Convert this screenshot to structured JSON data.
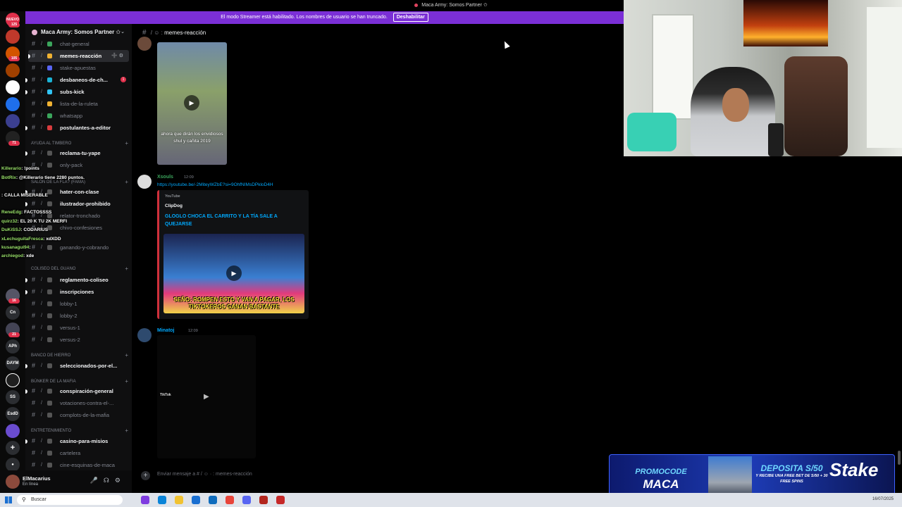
{
  "window": {
    "title": "Maca Army: Somos Partner ✩"
  },
  "banner": {
    "text": "El modo Streamer está habilitado. Los nombres de usuario se han truncado.",
    "button": "Deshabilitar"
  },
  "rail": {
    "badges": [
      "NUEVO",
      "125",
      "105",
      "71",
      "16",
      "21"
    ],
    "labels": [
      "APh",
      "DAYM",
      "SS",
      "EsdD",
      "Cn"
    ]
  },
  "server": {
    "name": "Maca Army: Somos Partner ✩"
  },
  "channels": [
    {
      "label": "chat-general",
      "bold": false,
      "color": "#3ba55c"
    },
    {
      "label": "memes-reacción",
      "bold": true,
      "active": true,
      "color": "#f0b232"
    },
    {
      "label": "stake-apuestas",
      "bold": false,
      "color": "#5865f2"
    },
    {
      "label": "desbaneos-de-ch...",
      "bold": true,
      "color": "#1bb3d6",
      "badge": "1"
    },
    {
      "label": "subs-kick",
      "bold": true,
      "color": "#31c4f3"
    },
    {
      "label": "lista-de-la-ruleta",
      "bold": false,
      "color": "#f0b232"
    },
    {
      "label": "whatsapp",
      "bold": false,
      "color": "#3ba55c"
    },
    {
      "label": "postulantes-a-editor",
      "bold": true,
      "color": "#d83c3e"
    }
  ],
  "categories": [
    {
      "label": "AYUDA AL TIMBERO"
    },
    {
      "label": "SALÓN DE LA FLA? (FAMA)"
    },
    {
      "label": "COLISEO DEL GUANO"
    },
    {
      "label": "BANCO DE HIERRO"
    },
    {
      "label": "BÚNKER DE LA MAFIA"
    },
    {
      "label": "ENTRETENIMIENTO"
    }
  ],
  "channels2": [
    {
      "label": "reclama-tu-yape",
      "bold": true
    },
    {
      "label": "only-pack",
      "bold": false
    },
    {
      "label": "hater-con-clase",
      "bold": true
    },
    {
      "label": "ilustrador-prohibido",
      "bold": true
    },
    {
      "label": "relator-tronchado",
      "bold": false
    },
    {
      "label": "chivo-confesiones",
      "bold": false
    },
    {
      "label": "ganando-y-cobrando",
      "bold": false
    },
    {
      "label": "reglamento-coliseo",
      "bold": true
    },
    {
      "label": "inscripciones",
      "bold": true
    },
    {
      "label": "lobby-1",
      "bold": false
    },
    {
      "label": "lobby-2",
      "bold": false
    },
    {
      "label": "versus-1",
      "bold": false
    },
    {
      "label": "versus-2",
      "bold": false
    },
    {
      "label": "seleccionados-por-el...",
      "bold": true
    },
    {
      "label": "conspiración-general",
      "bold": true
    },
    {
      "label": "votaciones-contra-el-...",
      "bold": false
    },
    {
      "label": "complots-de-la-mafia",
      "bold": false
    },
    {
      "label": "casino-para-misios",
      "bold": true
    },
    {
      "label": "cartelera",
      "bold": false
    },
    {
      "label": "cine-esquinas-de-maca",
      "bold": false
    }
  ],
  "chat_overlay": [
    {
      "user": "Killerario",
      "text": ": !points"
    },
    {
      "user": "BotRix",
      "text": ": @Killerario tiene 2280 puntos."
    },
    {
      "user": "",
      "text": ": CALLA MISERABLE"
    },
    {
      "user": "ReneEdg",
      "text": ": FACTOSSSS"
    },
    {
      "user": "quirz32",
      "text": ": EL 20 K TU 2K MERFI"
    },
    {
      "user": "DuKiSSJ",
      "text": ": CODARIUS"
    },
    {
      "user": "xLechuguitaFresca",
      "text": ": xdXDD"
    },
    {
      "user": "kusanagui94",
      "text": ":"
    },
    {
      "user": "archiegod",
      "text": ": xde"
    }
  ],
  "header": {
    "channel": "memes-reacción"
  },
  "messages": [
    {
      "user": "Xsouls",
      "time": "12:09",
      "link": "https://youtube.be/-2MiteyWZbE?si=9OhfNIMsDPkloD4H",
      "embed": {
        "provider": "YouTube",
        "author": "ClipDog",
        "title": "GLOGLO CHOCA EL CARRITO Y LA TÍA SALE A QUEJARSE",
        "caption": "SEÑO: ROMPEN ESTO Y VAN A PAGAR, LOS TIKTOKEROS  GANAN BASTANTE"
      }
    },
    {
      "user": "Minatoj",
      "time": "12:09",
      "video_label": "TikTok"
    }
  ],
  "video1_caption": "ahora que dirán los envidiosos shul y cañita 2019",
  "composer": {
    "placeholder": "Enviar mensaje a # / ☺ · : memes-reacción"
  },
  "user_panel": {
    "name": "ElMacarius",
    "status": "En línea"
  },
  "ad": {
    "promo_label": "PROMOCODE",
    "promo_code": "MACA",
    "deposit": "DEPOSITA S/50",
    "deposit_sub": "Y RECIBE UNA FREE BET DE S/50 + 30 FREE SPINS",
    "brand": "Stake"
  },
  "taskbar": {
    "search": "Buscar",
    "date": "16/07/2025"
  }
}
